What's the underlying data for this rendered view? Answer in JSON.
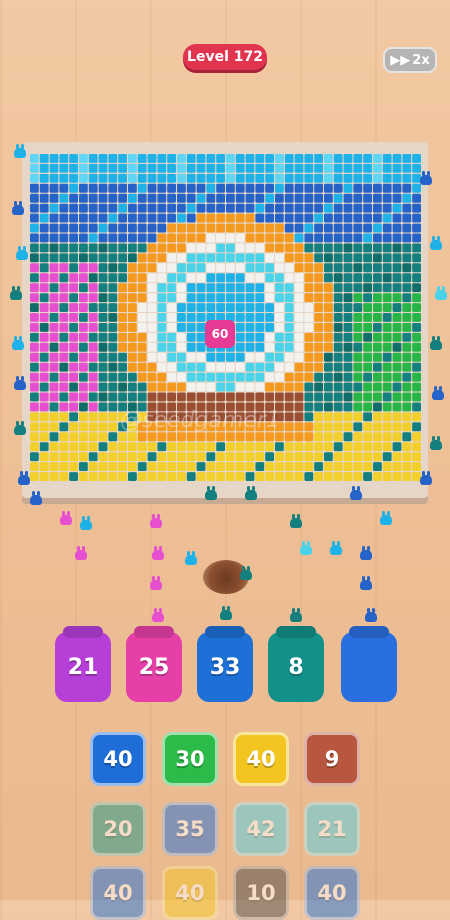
{
  "header": {
    "level_label": "Level 172",
    "speed_label": "2x"
  },
  "board": {
    "target_badge": "60",
    "watermark": "@seedgamer1"
  },
  "jars": [
    {
      "value": "21",
      "color": "#b63fd8"
    },
    {
      "value": "25",
      "color": "#e63fa8"
    },
    {
      "value": "33",
      "color": "#1f70d6"
    },
    {
      "value": "8",
      "color": "#139089"
    },
    {
      "value": "",
      "color": "#2a6fe0"
    }
  ],
  "tiles": [
    {
      "value": "40",
      "color": "#1f6ed8",
      "active": true
    },
    {
      "value": "30",
      "color": "#2cba48",
      "active": true
    },
    {
      "value": "40",
      "color": "#f2c521",
      "active": true
    },
    {
      "value": "9",
      "color": "#b8563f",
      "active": true
    },
    {
      "value": "20",
      "color": "#1a9b8a",
      "active": false
    },
    {
      "value": "35",
      "color": "#1f6ed8",
      "active": false
    },
    {
      "value": "42",
      "color": "#4fd2e8",
      "active": false
    },
    {
      "value": "21",
      "color": "#4fd2e8",
      "active": false
    },
    {
      "value": "40",
      "color": "#1f6ed8",
      "active": false
    },
    {
      "value": "40",
      "color": "#f2c521",
      "active": false
    },
    {
      "value": "10",
      "color": "#4a4a4a",
      "active": false
    },
    {
      "value": "40",
      "color": "#1f6ed8",
      "active": false
    }
  ],
  "palette": {
    "sky": "#1fb2e8",
    "skylight": "#5fd6f5",
    "blue": "#2563c9",
    "teal": "#137f7e",
    "pink": "#e64fd0",
    "green": "#27b548",
    "yellow": "#f2cf2a",
    "orange": "#f59a1f",
    "brown": "#9a4e32",
    "white": "#f4f2ef",
    "cyan": "#4bd3ea",
    "darkteal": "#0f6d6a"
  }
}
